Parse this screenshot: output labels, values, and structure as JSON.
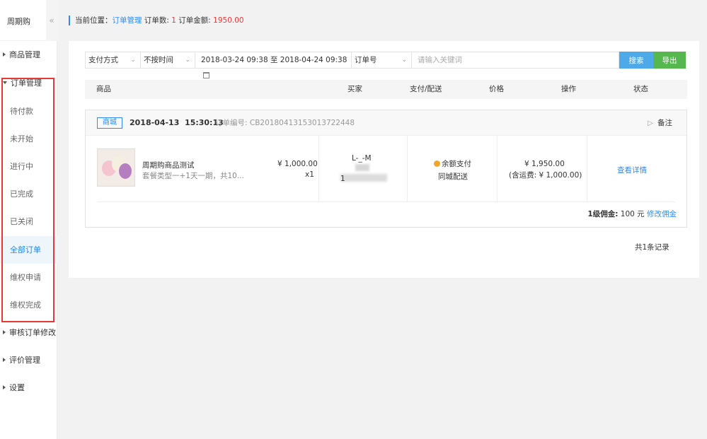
{
  "sidebar": {
    "brand": "周期购",
    "collapse_glyph": "«",
    "groups": {
      "goods": "商品管理",
      "orders": "订单管理",
      "audit": "审核订单修改",
      "reviews": "评价管理",
      "settings": "设置"
    },
    "order_items": [
      "待付款",
      "未开始",
      "进行中",
      "已完成",
      "已关闭",
      "全部订单",
      "维权申请",
      "维权完成"
    ],
    "active_item": "全部订单",
    "highlight_color": "#e53935"
  },
  "breadcrumb": {
    "prefix": "当前位置：",
    "page": "订单管理",
    "count_label": "订单数: ",
    "count_value": "1",
    "amount_label": "订单金额: ",
    "amount_value": "1950.00"
  },
  "filters": {
    "payment_method": "支付方式",
    "time_range": "不按时间",
    "date_range": "2018-03-24 09:38 至 2018-04-24 09:38",
    "search_field": "订单号",
    "keyword_placeholder": "请输入关键词",
    "search_button": "搜索",
    "export_button": "导出"
  },
  "table_headers": [
    "商品",
    "买家",
    "支付/配送",
    "价格",
    "操作",
    "状态"
  ],
  "order": {
    "source_tag": "商城",
    "date": "2018-04-13",
    "time": "15:30:13",
    "order_no_label": "订单编号: ",
    "order_no": "CB20180413153013722448",
    "remark": "备注",
    "product_name": "周期购商品测试",
    "product_desc": "套餐类型一+1天一期，共10...",
    "unit_price": "¥ 1,000.00",
    "quantity": "x1",
    "buyer_name": "L-_-M",
    "buyer_phone_visible": "1",
    "payment_type": "余额支付",
    "delivery_type": "同城配送",
    "total_price": "¥ 1,950.00",
    "freight_note": "(含运费: ¥ 1,000.00)",
    "action_link": "查看详情",
    "commission_label": "1级佣金:",
    "commission_value": "100 元",
    "commission_edit": "修改佣金"
  },
  "pagination": {
    "total_records": "共1条记录"
  },
  "colors": {
    "accent": "#2d8cf0",
    "search_button": "#4da9e8",
    "export_button": "#55b74e",
    "amount_red": "#e53935"
  }
}
